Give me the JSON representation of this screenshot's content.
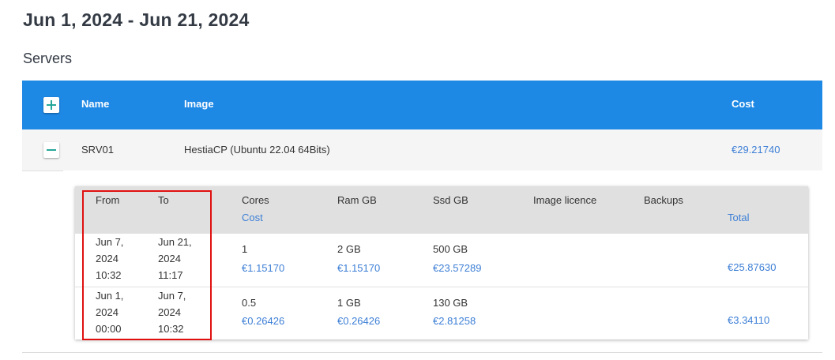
{
  "report": {
    "date_range": "Jun 1, 2024 - Jun 21, 2024",
    "section_title": "Servers"
  },
  "servers_table": {
    "headers": {
      "name": "Name",
      "image": "Image",
      "cost": "Cost"
    },
    "rows": [
      {
        "name": "SRV01",
        "image": "HestiaCP (Ubuntu 22.04 64Bits)",
        "cost": "€29.21740",
        "expanded": true
      }
    ]
  },
  "details_table": {
    "headers": {
      "from": "From",
      "to": "To",
      "cores": "Cores",
      "cost": "Cost",
      "ram": "Ram GB",
      "ssd": "Ssd GB",
      "image_licence": "Image licence",
      "backups": "Backups",
      "total": "Total"
    },
    "rows": [
      {
        "from": [
          "Jun 7,",
          "2024",
          "10:32"
        ],
        "to": [
          "Jun 21,",
          "2024",
          "11:17"
        ],
        "cores": "1",
        "cores_cost": "€1.15170",
        "ram": "2 GB",
        "ram_cost": "€1.15170",
        "ssd": "500 GB",
        "ssd_cost": "€23.57289",
        "total": "€25.87630"
      },
      {
        "from": [
          "Jun 1,",
          "2024",
          "00:00"
        ],
        "to": [
          "Jun 7,",
          "2024",
          "10:32"
        ],
        "cores": "0.5",
        "cores_cost": "€0.26426",
        "ram": "1 GB",
        "ram_cost": "€0.26426",
        "ssd": "130 GB",
        "ssd_cost": "€2.81258",
        "total": "€3.34110"
      }
    ]
  },
  "colors": {
    "header_blue": "#1e88e5",
    "link_blue": "#3d7fd6",
    "icon_green": "#26a69a",
    "highlight_red": "#e01010"
  },
  "icons": {
    "add": "plus-icon",
    "collapse": "minus-icon"
  }
}
